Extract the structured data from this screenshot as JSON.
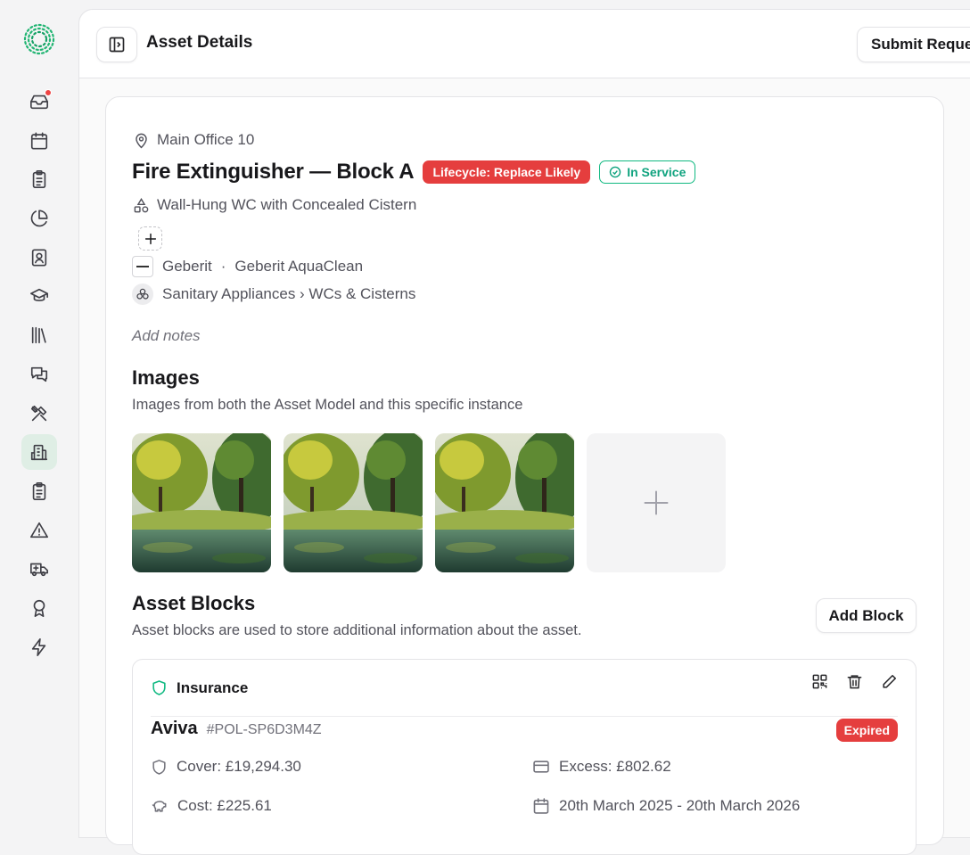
{
  "header": {
    "title": "Asset Details",
    "submit_label": "Submit Reque"
  },
  "asset": {
    "location": "Main Office 10",
    "name": "Fire Extinguisher — Block A",
    "lifecycle_badge": "Lifecycle: Replace Likely",
    "status_badge": "In Service",
    "model": "Wall-Hung WC with Concealed Cistern",
    "manufacturer": "Geberit",
    "separator": "·",
    "product_line": "Geberit AquaClean",
    "category": "Sanitary Appliances › WCs & Cisterns",
    "notes_placeholder": "Add notes"
  },
  "images": {
    "title": "Images",
    "subtitle": "Images from both the Asset Model and this specific instance"
  },
  "blocks": {
    "title": "Asset Blocks",
    "subtitle": "Asset blocks are used to store additional information about the asset.",
    "add_label": "Add Block",
    "insurance": {
      "label": "Insurance",
      "insurer": "Aviva",
      "policy": "#POL-SP6D3M4Z",
      "status": "Expired",
      "cover": "Cover: £19,294.30",
      "excess": "Excess: £802.62",
      "cost": "Cost: £225.61",
      "period": "20th March 2025 - 20th March 2026"
    }
  },
  "colors": {
    "accent_green": "#10b981",
    "danger_red": "#e53e3e",
    "active_nav_bg": "#dfeee5"
  },
  "sidebar": {
    "items": [
      {
        "icon": "inbox-icon",
        "active": false,
        "notification": true
      },
      {
        "icon": "calendar-icon",
        "active": false
      },
      {
        "icon": "clipboard-list-icon",
        "active": false
      },
      {
        "icon": "pie-chart-icon",
        "active": false
      },
      {
        "icon": "contact-book-icon",
        "active": false
      },
      {
        "icon": "graduation-cap-icon",
        "active": false
      },
      {
        "icon": "library-icon",
        "active": false
      },
      {
        "icon": "chat-icon",
        "active": false
      },
      {
        "icon": "tools-icon",
        "active": false
      },
      {
        "icon": "building-icon",
        "active": true
      },
      {
        "icon": "clipboard-check-icon",
        "active": false
      },
      {
        "icon": "warning-icon",
        "active": false
      },
      {
        "icon": "ambulance-icon",
        "active": false
      },
      {
        "icon": "award-icon",
        "active": false
      },
      {
        "icon": "lightning-icon",
        "active": false
      }
    ]
  }
}
